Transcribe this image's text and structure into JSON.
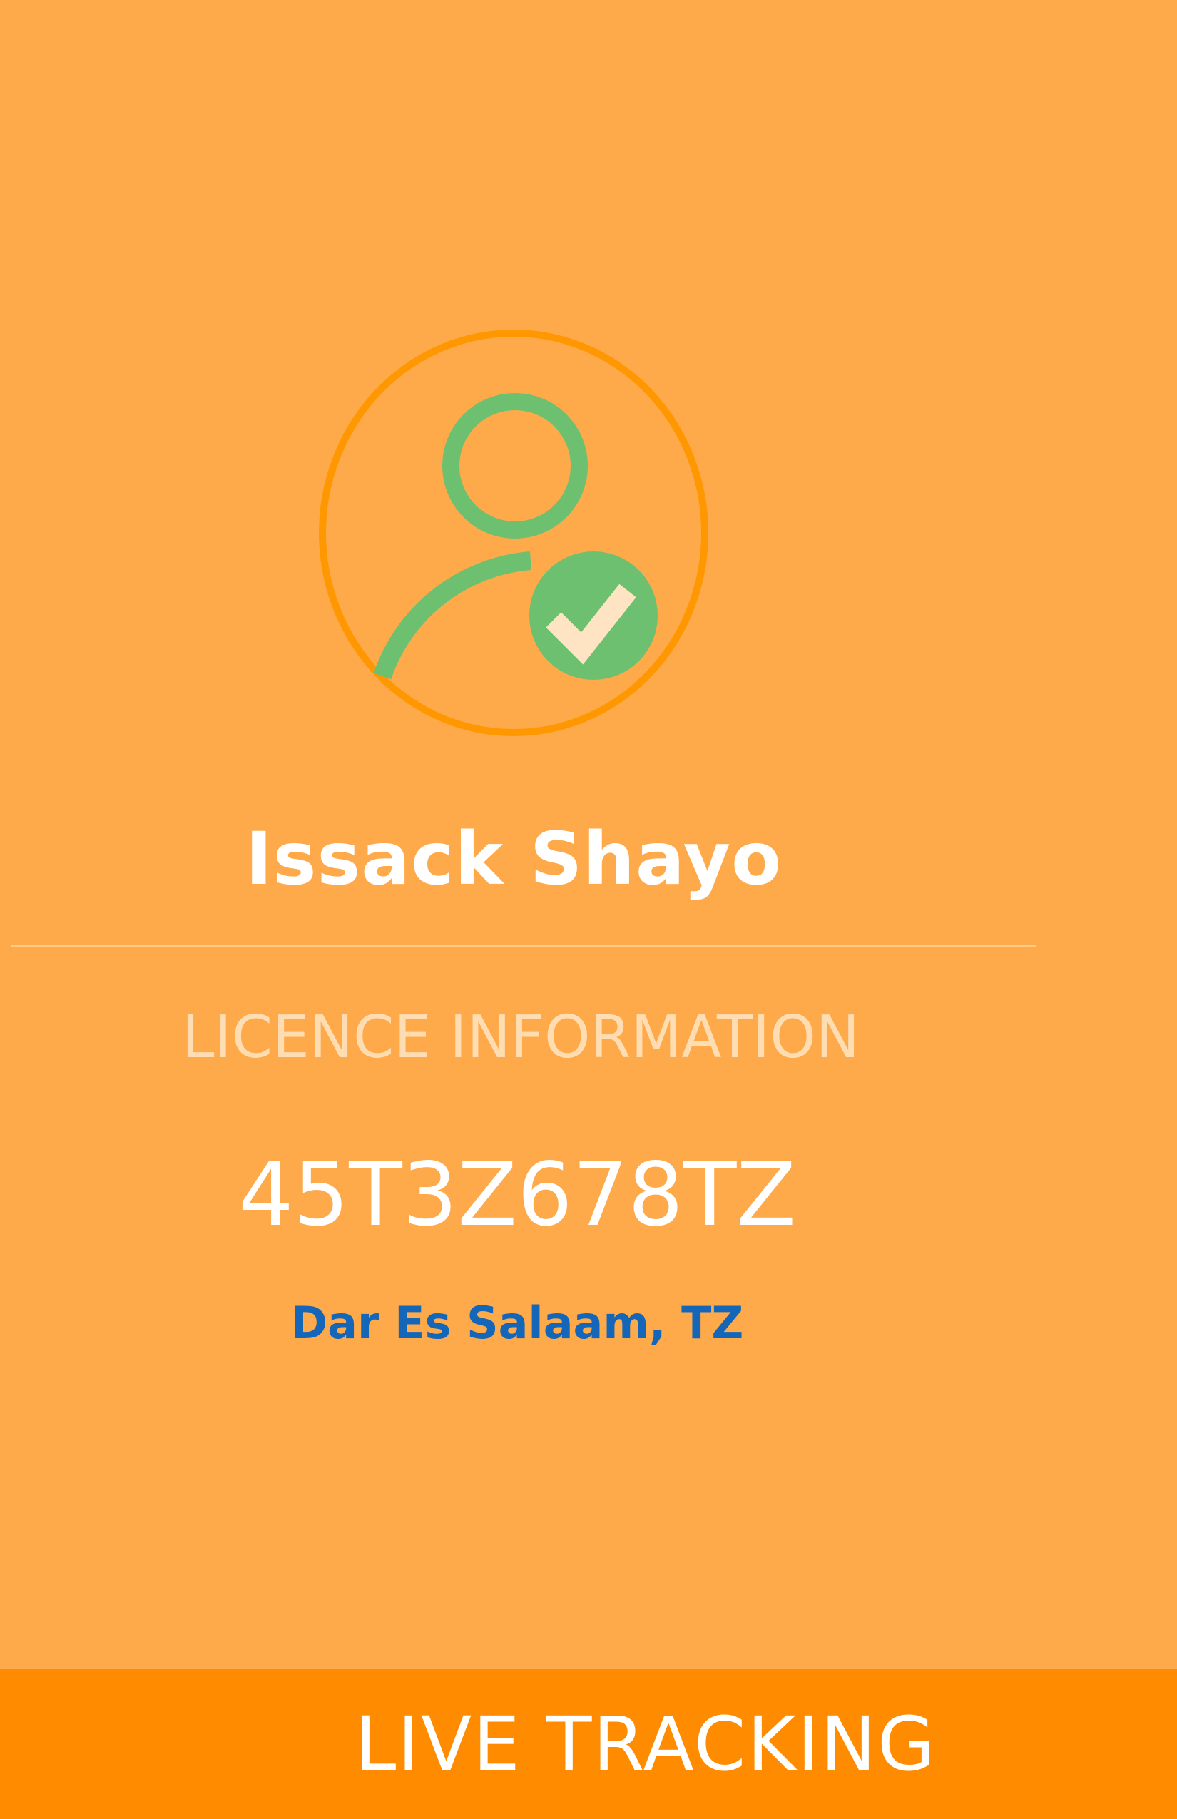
{
  "profile": {
    "avatar_icon": "verified-user-icon",
    "name": "Issack Shayo"
  },
  "licence": {
    "section_label": "LICENCE INFORMATION",
    "number": "45T3Z678TZ",
    "location": "Dar Es Salaam, TZ"
  },
  "footer": {
    "button_label": "LIVE TRACKING"
  },
  "colors": {
    "background": "#FFAA4A",
    "button": "#FF8C00",
    "avatar_ring": "#FF9800",
    "avatar_icon": "#6CC070",
    "location_text": "#1467B8"
  }
}
